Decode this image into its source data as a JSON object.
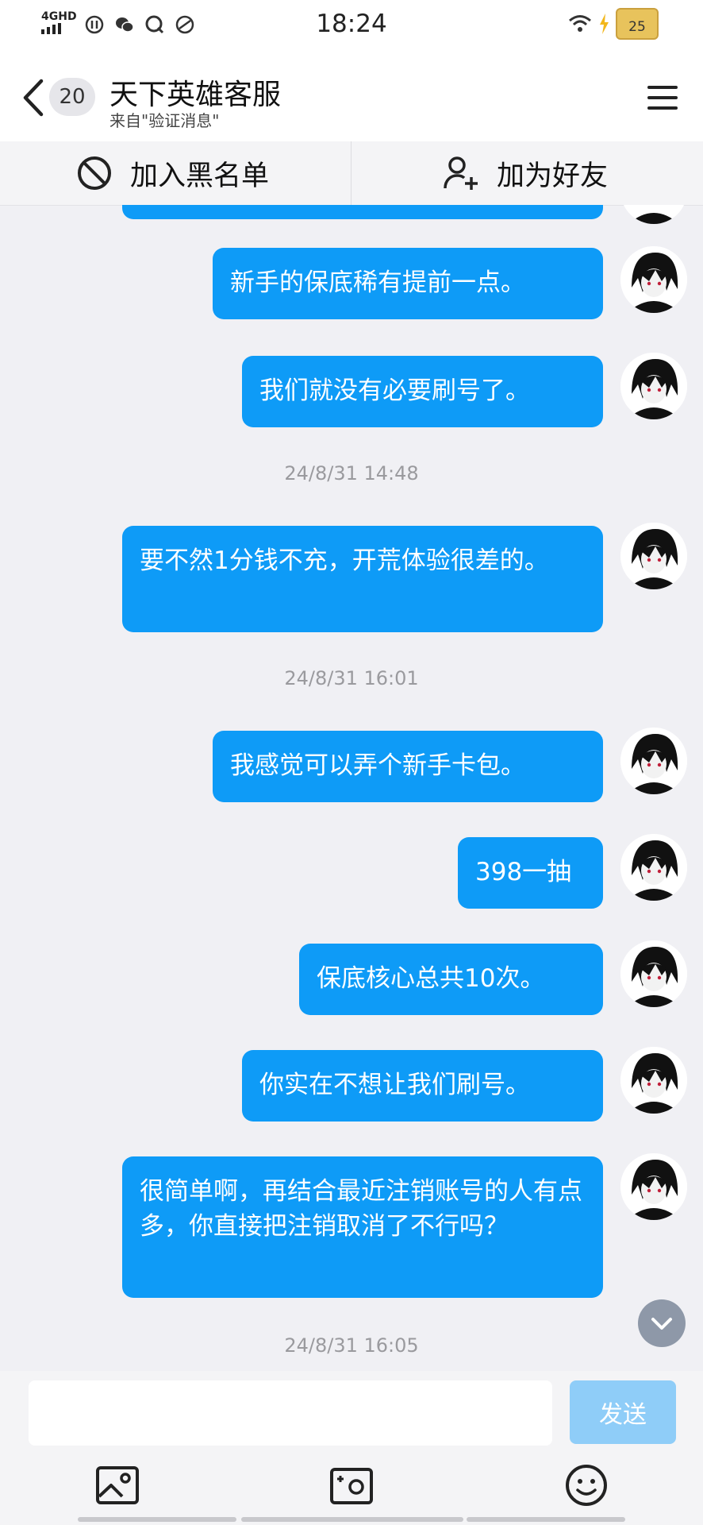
{
  "status_bar": {
    "network": "4GHD",
    "time": "18:24",
    "battery": "25"
  },
  "header": {
    "unread_count": "20",
    "title": "天下英雄客服",
    "subtitle": "来自\"验证消息\""
  },
  "actions": {
    "block_label": "加入黑名单",
    "add_friend_label": "加为好友"
  },
  "messages": [
    {
      "text": "新手的保底稀有提前一点。"
    },
    {
      "text": "我们就没有必要刷号了。"
    },
    {
      "text": "要不然1分钱不充，开荒体验很差的。"
    },
    {
      "text": "我感觉可以弄个新手卡包。"
    },
    {
      "text": "398一抽"
    },
    {
      "text": "保底核心总共10次。"
    },
    {
      "text": "你实在不想让我们刷号。"
    },
    {
      "text": "很简单啊，再结合最近注销账号的人有点多，你直接把注销取消了不行吗？"
    }
  ],
  "timestamps": [
    "24/8/31 14:48",
    "24/8/31 16:01",
    "24/8/31 16:05"
  ],
  "input": {
    "placeholder": "",
    "send_label": "发送"
  },
  "colors": {
    "bubble": "#0e9bf7",
    "send_disabled": "#8fcdf8"
  }
}
